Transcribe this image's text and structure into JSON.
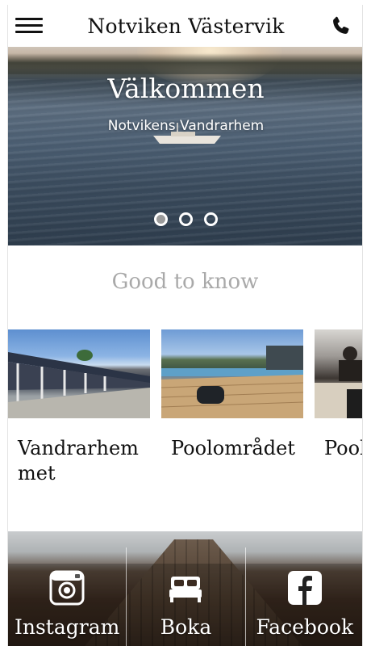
{
  "header": {
    "title": "Notviken Västervik",
    "menu_icon": "hamburger-menu-icon",
    "phone_icon": "phone-icon"
  },
  "hero": {
    "title": "Välkommen",
    "subtitle": "Notvikens Vandrarhem",
    "slide_count": 3,
    "active_slide": 1
  },
  "section": {
    "title": "Good to know"
  },
  "cards": [
    {
      "label": "Vandrarhemmet",
      "label_line1": "Vandrarhem",
      "label_line2": "met"
    },
    {
      "label": "Poolområdet",
      "label_line1": "Poolområdet",
      "label_line2": ""
    },
    {
      "label": "Pool",
      "label_line1": "Pool",
      "label_line2": ""
    }
  ],
  "tabs": [
    {
      "label": "Instagram",
      "icon": "instagram-icon"
    },
    {
      "label": "Boka",
      "icon": "bed-icon"
    },
    {
      "label": "Facebook",
      "icon": "facebook-icon"
    }
  ],
  "colors": {
    "title_text": "#111111",
    "section_title": "#a9a9a9",
    "white": "#ffffff"
  }
}
